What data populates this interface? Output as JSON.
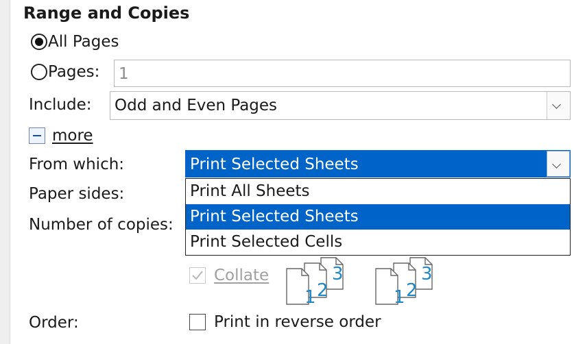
{
  "section": {
    "title": "Range and Copies"
  },
  "range": {
    "all_pages": {
      "label": "All Pages",
      "checked": true
    },
    "pages": {
      "label": "Pages:",
      "value": "1",
      "checked": false
    }
  },
  "include": {
    "label": "Include:",
    "value": "Odd and Even Pages"
  },
  "more": {
    "label": "more",
    "expanded": true
  },
  "from_which": {
    "label": "From which:",
    "value": "Print Selected Sheets",
    "options": [
      "Print All Sheets",
      "Print Selected Sheets",
      "Print Selected Cells"
    ],
    "selected_index": 1
  },
  "paper_sides": {
    "label": "Paper sides:"
  },
  "copies": {
    "label": "Number of copies:"
  },
  "collate": {
    "label": "Collate",
    "checked": true,
    "enabled": false
  },
  "collate_icons": {
    "page_numbers": [
      "1",
      "2",
      "3"
    ]
  },
  "order": {
    "label": "Order:",
    "reverse_label": "Print in reverse order",
    "reverse_checked": false
  },
  "colors": {
    "accent": "#0063c8",
    "icon_blue": "#1e88c8"
  }
}
